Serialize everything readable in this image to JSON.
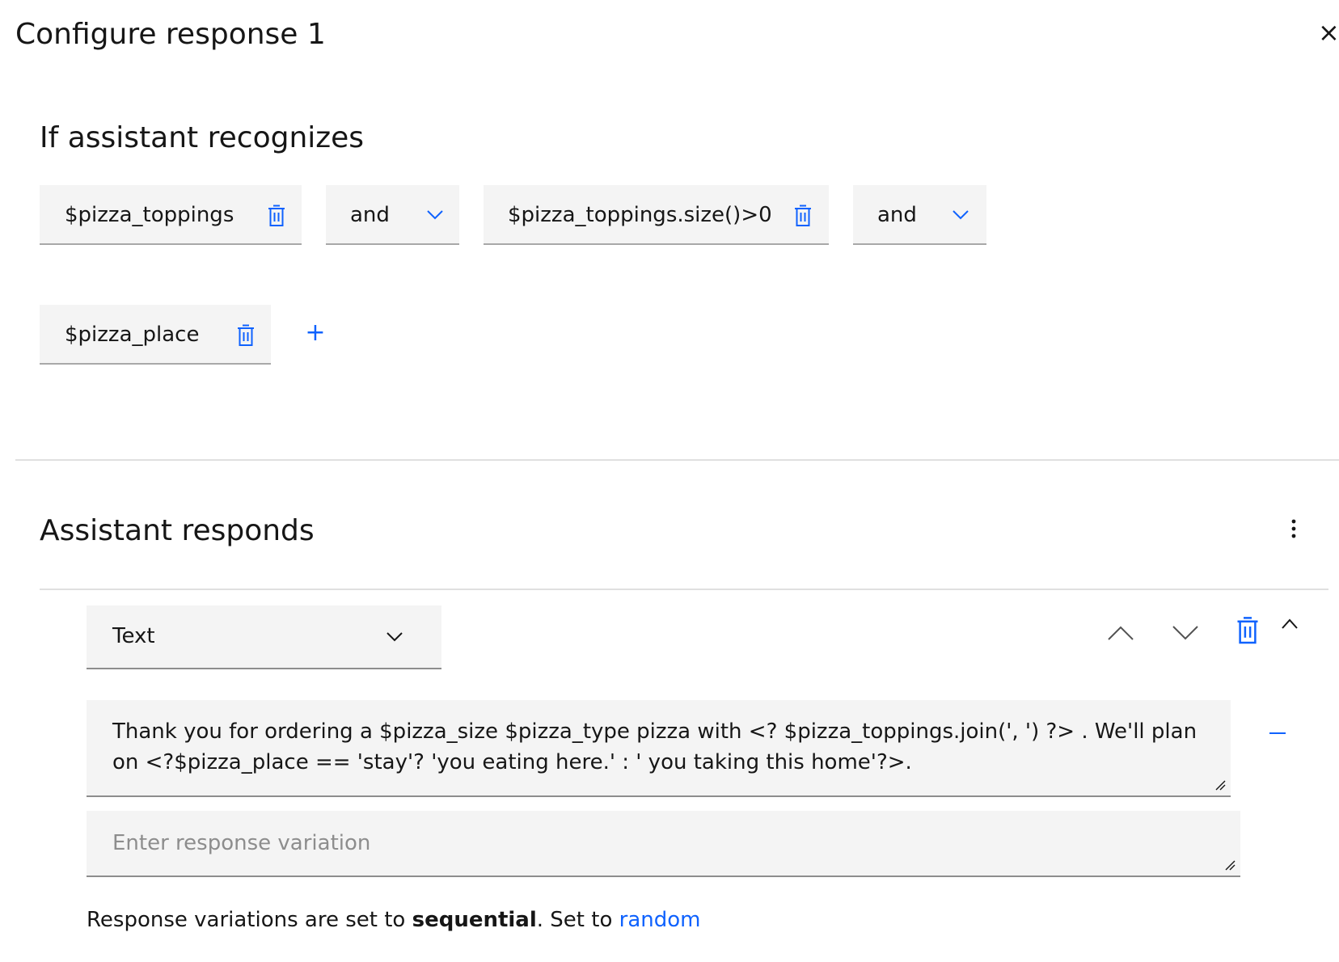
{
  "modal": {
    "title": "Configure response 1",
    "close_icon": "close-icon"
  },
  "conditions": {
    "heading": "If assistant recognizes",
    "chips": [
      {
        "label": "$pizza_toppings",
        "icon": "trash-icon"
      },
      {
        "label": "$pizza_toppings.size()>0",
        "icon": "trash-icon"
      },
      {
        "label": "$pizza_place",
        "icon": "trash-icon"
      }
    ],
    "operators": [
      {
        "value": "and",
        "icon": "chevron-down-icon"
      },
      {
        "value": "and",
        "icon": "chevron-down-icon"
      }
    ],
    "add_icon": "plus-icon"
  },
  "responds": {
    "heading": "Assistant responds",
    "overflow_icon": "overflow-menu-icon",
    "type_select": {
      "value": "Text",
      "icon": "chevron-down-icon"
    },
    "controls": {
      "move_up_icon": "chevron-up-icon",
      "move_down_icon": "chevron-down-icon",
      "delete_icon": "trash-icon",
      "collapse_icon": "chevron-up-icon"
    },
    "response_text": "Thank you for ordering a $pizza_size $pizza_type pizza with <? $pizza_toppings.join(', ') ?> . We'll plan on <?$pizza_place == 'stay'? 'you eating here.' :  ' you taking this home'?>.",
    "remove_icon": "minus-icon",
    "variation_placeholder": "Enter response variation",
    "footer": {
      "prefix": "Response variations are set to ",
      "mode": "sequential",
      "middle": ". Set to ",
      "link": "random"
    }
  },
  "colors": {
    "accent": "#0f62fe",
    "field_bg": "#f4f4f4",
    "text": "#161616",
    "placeholder": "#8d8d8d"
  }
}
